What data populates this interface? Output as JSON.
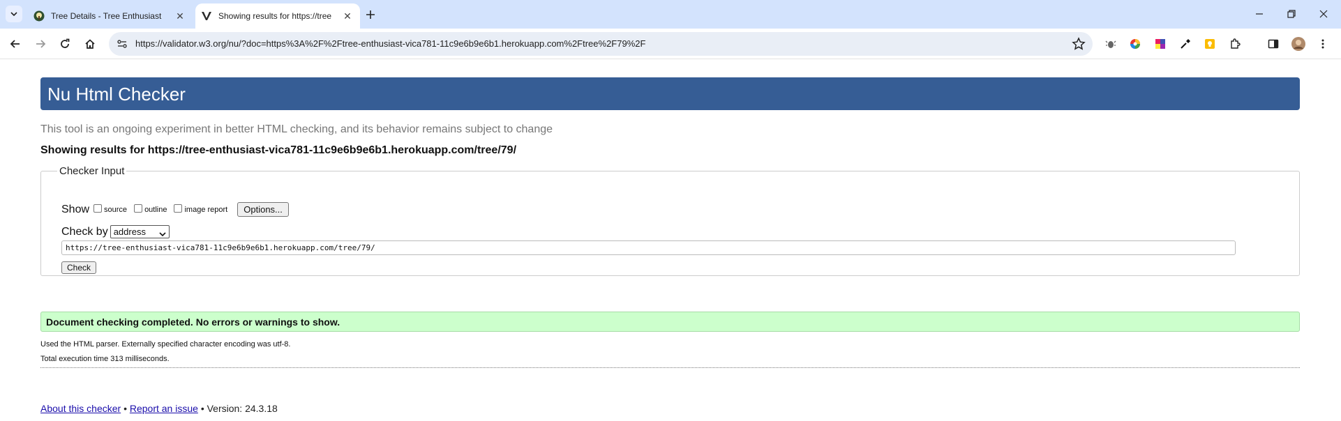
{
  "browser": {
    "tabs": [
      {
        "title": "Tree Details - Tree Enthusiast",
        "active": false
      },
      {
        "title": "Showing results for https://tree",
        "active": true
      }
    ],
    "address_bar": {
      "url": "https://validator.w3.org/nu/?doc=https%3A%2F%2Ftree-enthusiast-vica781-11c9e6b9e6b1.herokuapp.com%2Ftree%2F79%2F"
    },
    "icons": [
      "tab-search-icon",
      "close-icon",
      "new-tab-icon",
      "minimize-icon",
      "restore-icon",
      "window-close-icon",
      "back-icon",
      "forward-icon",
      "reload-icon",
      "home-icon",
      "site-info-icon",
      "bookmark-star-icon",
      "extensions-icon",
      "side-panel-icon",
      "profile-avatar",
      "more-menu-icon"
    ]
  },
  "page": {
    "heading": "Nu Html Checker",
    "intro": "This tool is an ongoing experiment in better HTML checking, and its behavior remains subject to change",
    "showing_results": "Showing results for https://tree-enthusiast-vica781-11c9e6b9e6b1.herokuapp.com/tree/79/",
    "checker_input": {
      "legend": "Checker Input",
      "show_label": "Show",
      "show_options": [
        {
          "label": "source",
          "checked": false
        },
        {
          "label": "outline",
          "checked": false
        },
        {
          "label": "image report",
          "checked": false
        }
      ],
      "options_button": "Options...",
      "check_by_label": "Check by",
      "check_by_value": "address",
      "url_value": "https://tree-enthusiast-vica781-11c9e6b9e6b1.herokuapp.com/tree/79/",
      "check_button": "Check"
    },
    "result": {
      "message": "Document checking completed. No errors or warnings to show.",
      "parser_note": "Used the HTML parser. Externally specified character encoding was utf-8.",
      "exec_time": "Total execution time 313 milliseconds."
    },
    "footer": {
      "about_link": "About this checker",
      "separator": "•",
      "report_link": "Report an issue",
      "version": "Version: 24.3.18"
    }
  },
  "colors": {
    "tabstrip": "#d3e3fd",
    "header_bar": "#365d95",
    "success_bg": "#ccffcc",
    "link": "#1a0dab"
  }
}
